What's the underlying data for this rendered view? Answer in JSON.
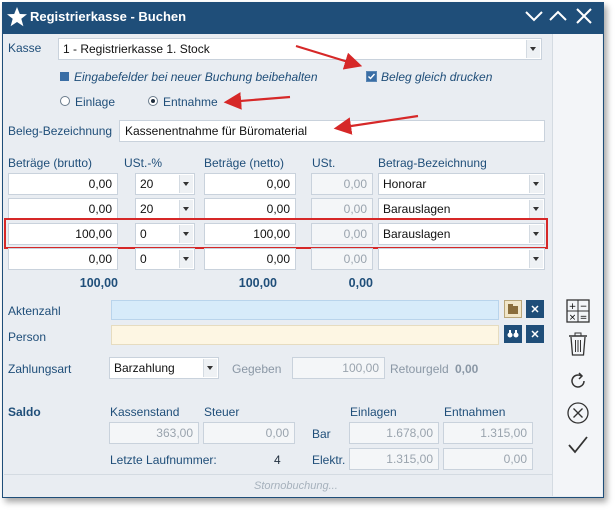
{
  "window": {
    "title": "Registrierkasse - Buchen"
  },
  "kasse": {
    "label": "Kasse",
    "value": "1 - Registrierkasse 1. Stock"
  },
  "options": {
    "keep_fields": "Eingabefelder bei neuer Buchung beibehalten",
    "print_receipt": "Beleg gleich drucken",
    "einlage": "Einlage",
    "entnahme": "Entnahme"
  },
  "beleg": {
    "label": "Beleg-Bezeichnung",
    "value": "Kassenentnahme für Büromaterial"
  },
  "table": {
    "headers": {
      "brutto": "Beträge (brutto)",
      "ust_pct": "USt.-%",
      "netto": "Beträge (netto)",
      "ust": "USt.",
      "bezeichnung": "Betrag-Bezeichnung"
    },
    "rows": [
      {
        "brutto": "0,00",
        "ust_pct": "20",
        "netto": "0,00",
        "ust": "0,00",
        "bezeichnung": "Honorar"
      },
      {
        "brutto": "0,00",
        "ust_pct": "20",
        "netto": "0,00",
        "ust": "0,00",
        "bezeichnung": "Barauslagen"
      },
      {
        "brutto": "100,00",
        "ust_pct": "0",
        "netto": "100,00",
        "ust": "0,00",
        "bezeichnung": "Barauslagen"
      },
      {
        "brutto": "0,00",
        "ust_pct": "0",
        "netto": "0,00",
        "ust": "0,00",
        "bezeichnung": ""
      }
    ],
    "totals": {
      "brutto": "100,00",
      "netto": "100,00",
      "ust": "0,00"
    }
  },
  "aktenzahl": {
    "label": "Aktenzahl",
    "value": ""
  },
  "person": {
    "label": "Person",
    "value": ""
  },
  "zahlung": {
    "label": "Zahlungsart",
    "value": "Barzahlung",
    "gegeben_label": "Gegeben",
    "gegeben_value": "100,00",
    "retourgeld_label": "Retourgeld",
    "retourgeld_value": "0,00"
  },
  "saldo": {
    "label": "Saldo",
    "kassenstand_label": "Kassenstand",
    "kassenstand_value": "363,00",
    "steuer_label": "Steuer",
    "steuer_value": "0,00",
    "einlagen_label": "Einlagen",
    "entnahmen_label": "Entnahmen",
    "bar_label": "Bar",
    "bar_einlagen": "1.678,00",
    "bar_entnahmen": "1.315,00",
    "elektr_label": "Elektr.",
    "elektr_einlagen": "1.315,00",
    "elektr_entnahmen": "0,00",
    "laufnummer_label": "Letzte Laufnummer:",
    "laufnummer_value": "4"
  },
  "footer": {
    "storno": "Stornobuchung..."
  },
  "colors": {
    "titlebar": "#1f4e79",
    "accent": "#d62828",
    "aktenzahl_bg": "#d7ebfa",
    "person_bg": "#fdf6e3"
  }
}
